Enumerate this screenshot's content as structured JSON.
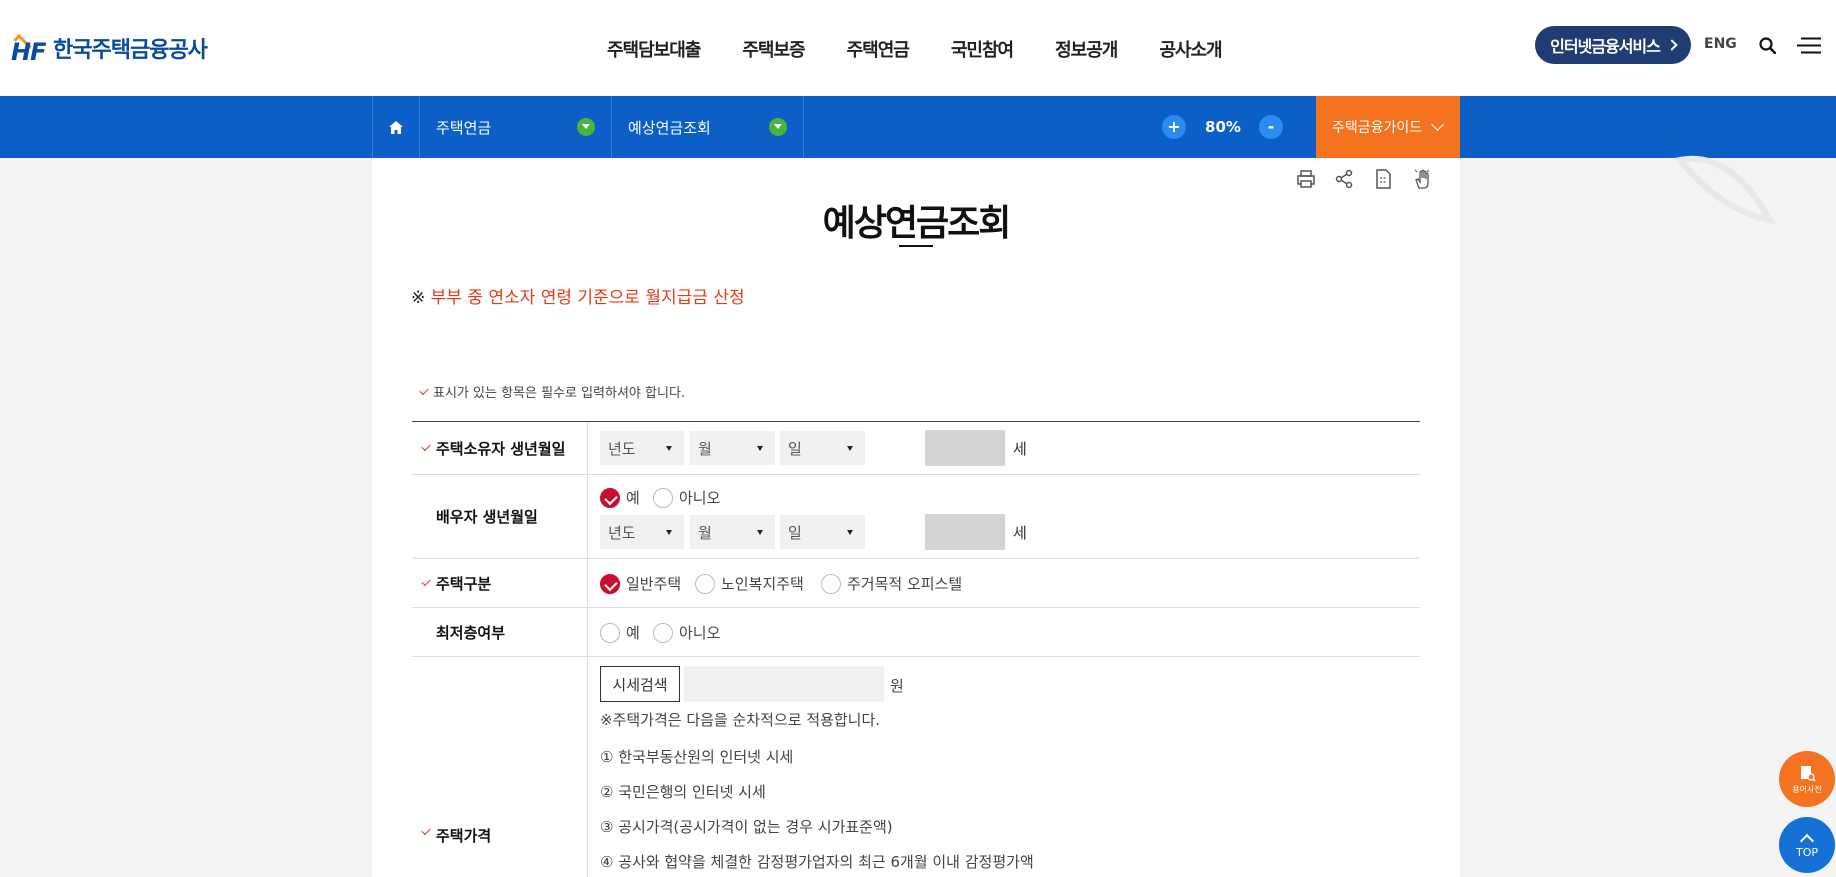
{
  "header": {
    "logo_mark": "HF",
    "logo_text": "한국주택금융공사",
    "nav": [
      "주택담보대출",
      "주택보증",
      "주택연금",
      "국민참여",
      "정보공개",
      "공사소개"
    ],
    "internet_service": "인터넷금융서비스",
    "eng": "ENG"
  },
  "subbar": {
    "depth1": "주택연금",
    "depth2": "예상연금조회",
    "zoom_in": "+",
    "zoom_value": "80%",
    "zoom_out": "-",
    "guide": "주택금융가이드"
  },
  "page": {
    "title": "예상연금조회",
    "notice_prefix": "※ ",
    "notice": "부부 중 연소자 연령 기준으로 월지급금 산정",
    "required_note": "표시가 있는 항목은 필수로 입력하셔야 합니다."
  },
  "form": {
    "owner_birth": {
      "label": "주택소유자 생년월일",
      "year": "년도",
      "month": "월",
      "day": "일",
      "age_unit": "세"
    },
    "spouse_birth": {
      "label": "배우자 생년월일",
      "yes": "예",
      "no": "아니오",
      "year": "년도",
      "month": "월",
      "day": "일",
      "age_unit": "세"
    },
    "house_type": {
      "label": "주택구분",
      "opt1": "일반주택",
      "opt2": "노인복지주택",
      "opt3": "주거목적 오피스텔"
    },
    "lowest_floor": {
      "label": "최저층여부",
      "yes": "예",
      "no": "아니오"
    },
    "house_price": {
      "label": "주택가격",
      "search_btn": "시세검색",
      "unit": "원",
      "note": "※주택가격은 다음을 순차적으로 적용합니다.",
      "items": [
        "① 한국부동산원의 인터넷 시세",
        "② 국민은행의 인터넷 시세",
        "③ 공시가격(공시가격이 없는 경우 시가표준액)",
        "④ 공사와 협약을 체결한 감정평가업자의 최근 6개월 이내 감정평가액"
      ]
    }
  },
  "floating": {
    "dict": "용어사전",
    "top": "TOP"
  },
  "colors": {
    "primary_blue": "#0b5fc6",
    "navy": "#1f3d73",
    "orange": "#f37320",
    "notice_red": "#e33b14",
    "radio_checked": "#c8102e"
  }
}
